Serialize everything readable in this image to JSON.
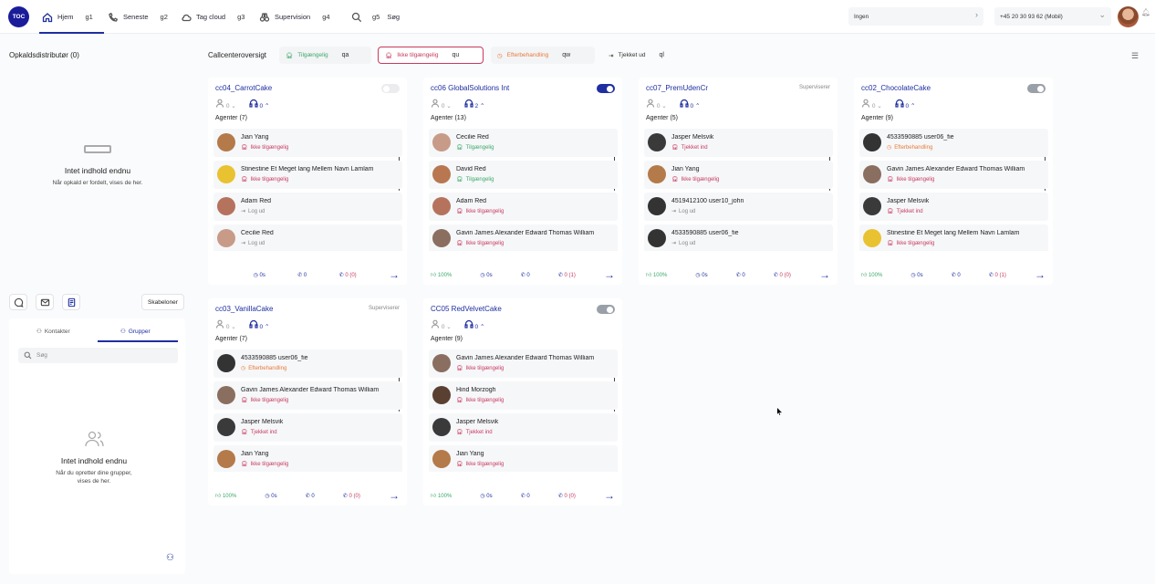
{
  "topbar": {
    "logo": "TOC",
    "nav": [
      {
        "label": "Hjem",
        "key": "g1"
      },
      {
        "label": "Seneste",
        "key": "g2"
      },
      {
        "label": "Tag cloud",
        "key": "g3"
      },
      {
        "label": "Supervision",
        "key": "g4"
      },
      {
        "label": "Søg",
        "key": "g5"
      }
    ],
    "select1": "Ingen",
    "select2": "+45 20 30 93 62 (Mobil)"
  },
  "left": {
    "title": "Opkaldsdistributør (0)",
    "empty_title": "Intet indhold endnu",
    "empty_sub": "Når opkald er fordelt, vises de her.",
    "templates_label": "Skabeloner",
    "tabs": [
      "Kontakter",
      "Grupper"
    ],
    "search_placeholder": "Søg",
    "groups_empty_title": "Intet indhold endnu",
    "groups_empty_sub": "Når du opretter dine grupper, vises de her."
  },
  "overview": {
    "title": "Callcenteroversigt",
    "statuses": [
      {
        "label": "Tilgængelig",
        "key": "qa",
        "tone": "green"
      },
      {
        "label": "Ikke tilgængelig",
        "key": "qu",
        "tone": "red"
      },
      {
        "label": "Efterbehandling",
        "key": "qw",
        "tone": "orange"
      },
      {
        "label": "Tjekket ud",
        "key": "ql",
        "tone": "grey"
      }
    ]
  },
  "cards": [
    {
      "title": "cc04_CarrotCake",
      "badge": "",
      "toggle": "faint",
      "waiting": "0",
      "available": "0",
      "agents_label": "Agenter (7)",
      "agents": [
        {
          "name": "Jian Yang",
          "status": "Ikke tilgængelig",
          "tone": "red",
          "av": "#b47a4a"
        },
        {
          "name": "Stinestine Et Meget lang Mellem Navn Lamlam",
          "status": "Ikke tilgængelig",
          "tone": "red",
          "av": "#e9c232"
        },
        {
          "name": "Adam Red",
          "status": "Log ud",
          "tone": "grey",
          "av": "#b5735d"
        },
        {
          "name": "Cecilie Red",
          "status": "Log ud",
          "tone": "grey",
          "av": "#c79b88"
        }
      ],
      "foot": {
        "rate": "",
        "avg": "0s",
        "calls": "0",
        "missed": "0 (0)"
      }
    },
    {
      "title": "cc06 GlobalSolutions Int",
      "badge": "",
      "toggle": "on",
      "waiting": "0",
      "available": "2",
      "agents_label": "Agenter (13)",
      "agents": [
        {
          "name": "Cecilie Red",
          "status": "Tilgængelig",
          "tone": "green",
          "av": "#c79b88"
        },
        {
          "name": "David Red",
          "status": "Tilgængelig",
          "tone": "green",
          "av": "#b87750"
        },
        {
          "name": "Adam Red",
          "status": "Ikke tilgængelig",
          "tone": "red",
          "av": "#b5735d"
        },
        {
          "name": "Gavin James Alexander Edward Thomas William",
          "status": "Ikke tilgængelig",
          "tone": "red",
          "av": "#8a6e60"
        }
      ],
      "foot": {
        "rate": "100%",
        "avg": "0s",
        "calls": "0",
        "missed": "0 (1)"
      }
    },
    {
      "title": "cc07_PremUdenCr",
      "badge": "Superviserer",
      "toggle": "",
      "waiting": "0",
      "available": "0",
      "agents_label": "Agenter (5)",
      "agents": [
        {
          "name": "Jasper Melsvik",
          "status": "Tjekket ind",
          "tone": "red",
          "av": "#3a3a3a"
        },
        {
          "name": "Jian Yang",
          "status": "Ikke tilgængelig",
          "tone": "red",
          "av": "#b47a4a"
        },
        {
          "name": "4519412100 user10_john",
          "status": "Log ud",
          "tone": "grey",
          "av": "#333"
        },
        {
          "name": "4533590885 user06_fie",
          "status": "Log ud",
          "tone": "grey",
          "av": "#333"
        }
      ],
      "foot": {
        "rate": "100%",
        "avg": "0s",
        "calls": "0",
        "missed": "0 (0)"
      }
    },
    {
      "title": "cc02_ChocolateCake",
      "badge": "",
      "toggle": "off",
      "waiting": "0",
      "available": "0",
      "agents_label": "Agenter (9)",
      "agents": [
        {
          "name": "4533590885 user06_fie",
          "status": "Efterbehandling",
          "tone": "orange",
          "av": "#333"
        },
        {
          "name": "Gavin James Alexander Edward Thomas William",
          "status": "Ikke tilgængelig",
          "tone": "red",
          "av": "#8a6e60"
        },
        {
          "name": "Jasper Melsvik",
          "status": "Tjekket ind",
          "tone": "red",
          "av": "#3a3a3a"
        },
        {
          "name": "Stinestine Et Meget lang Mellem Navn Lamlam",
          "status": "Ikke tilgængelig",
          "tone": "red",
          "av": "#e9c232"
        }
      ],
      "foot": {
        "rate": "100%",
        "avg": "0s",
        "calls": "0",
        "missed": "0 (1)"
      }
    },
    {
      "title": "cc03_VanillaCake",
      "badge": "Superviserer",
      "toggle": "",
      "waiting": "0",
      "available": "0",
      "agents_label": "Agenter (7)",
      "agents": [
        {
          "name": "4533590885 user06_fie",
          "status": "Efterbehandling",
          "tone": "orange",
          "av": "#333"
        },
        {
          "name": "Gavin James Alexander Edward Thomas William",
          "status": "Ikke tilgængelig",
          "tone": "red",
          "av": "#8a6e60"
        },
        {
          "name": "Jasper Melsvik",
          "status": "Tjekket ind",
          "tone": "red",
          "av": "#3a3a3a"
        },
        {
          "name": "Jian Yang",
          "status": "Ikke tilgængelig",
          "tone": "red",
          "av": "#b47a4a"
        }
      ],
      "foot": {
        "rate": "100%",
        "avg": "0s",
        "calls": "0",
        "missed": "0 (0)"
      }
    },
    {
      "title": "CC05 RedVelvetCake",
      "badge": "",
      "toggle": "off",
      "waiting": "0",
      "available": "0",
      "agents_label": "Agenter (9)",
      "agents": [
        {
          "name": "Gavin James Alexander Edward Thomas William",
          "status": "Ikke tilgængelig",
          "tone": "red",
          "av": "#8a6e60"
        },
        {
          "name": "Hind Morzogh",
          "status": "Ikke tilgængelig",
          "tone": "red",
          "av": "#5a4030"
        },
        {
          "name": "Jasper Melsvik",
          "status": "Tjekket ind",
          "tone": "red",
          "av": "#3a3a3a"
        },
        {
          "name": "Jian Yang",
          "status": "Ikke tilgængelig",
          "tone": "red",
          "av": "#b47a4a"
        }
      ],
      "foot": {
        "rate": "100%",
        "avg": "0s",
        "calls": "0",
        "missed": "0 (0)"
      }
    }
  ]
}
